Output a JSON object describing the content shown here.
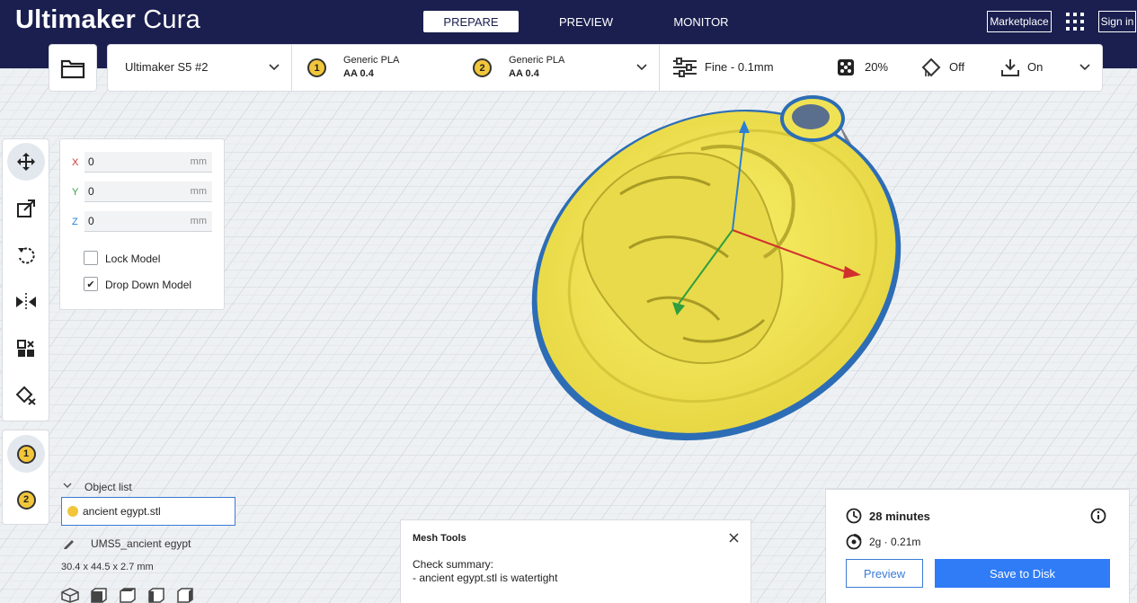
{
  "header": {
    "logo_primary": "Ultimaker",
    "logo_secondary": "Cura",
    "tabs": [
      {
        "label": "PREPARE",
        "active": true
      },
      {
        "label": "PREVIEW",
        "active": false
      },
      {
        "label": "MONITOR",
        "active": false
      }
    ],
    "marketplace_label": "Marketplace",
    "signin_label": "Sign in"
  },
  "printer": {
    "name": "Ultimaker S5 #2",
    "extruders": [
      {
        "number": "1",
        "material": "Generic PLA",
        "core": "AA 0.4"
      },
      {
        "number": "2",
        "material": "Generic PLA",
        "core": "AA 0.4"
      }
    ]
  },
  "print_settings": {
    "profile": "Fine - 0.1mm",
    "infill": "20%",
    "support": "Off",
    "adhesion": "On"
  },
  "tools": {
    "items": [
      "move-icon",
      "scale-icon",
      "rotate-icon",
      "mirror-icon",
      "per-model-settings-icon",
      "support-blocker-icon"
    ],
    "active": "move-icon"
  },
  "move_panel": {
    "x_label": "X",
    "x_value": "0",
    "y_label": "Y",
    "y_value": "0",
    "z_label": "Z",
    "z_value": "0",
    "unit": "mm",
    "lock_model_label": "Lock Model",
    "lock_model_checked": false,
    "drop_down_label": "Drop Down Model",
    "drop_down_checked": true
  },
  "extruder_selector": [
    "1",
    "2"
  ],
  "object_list": {
    "title": "Object list",
    "items": [
      {
        "name": "ancient egypt.stl"
      }
    ],
    "job_name": "UMS5_ancient egypt",
    "dimensions": "30.4 x 44.5 x 2.7 mm"
  },
  "mesh_tools": {
    "title": "Mesh Tools",
    "summary_title": "Check summary:",
    "summary_line": "- ancient egypt.stl is watertight"
  },
  "print_summary": {
    "time": "28 minutes",
    "material": "2g · 0.21m",
    "preview_label": "Preview",
    "save_label": "Save to Disk"
  },
  "colors": {
    "header_bg": "#1a1f4f",
    "accent_blue": "#2f7cf6",
    "model_yellow": "#f5ea5a",
    "extruder_yellow": "#f2c63a",
    "axis_x": "#d0312d",
    "axis_y": "#2a7fd4",
    "axis_z": "#2e9e3e"
  }
}
